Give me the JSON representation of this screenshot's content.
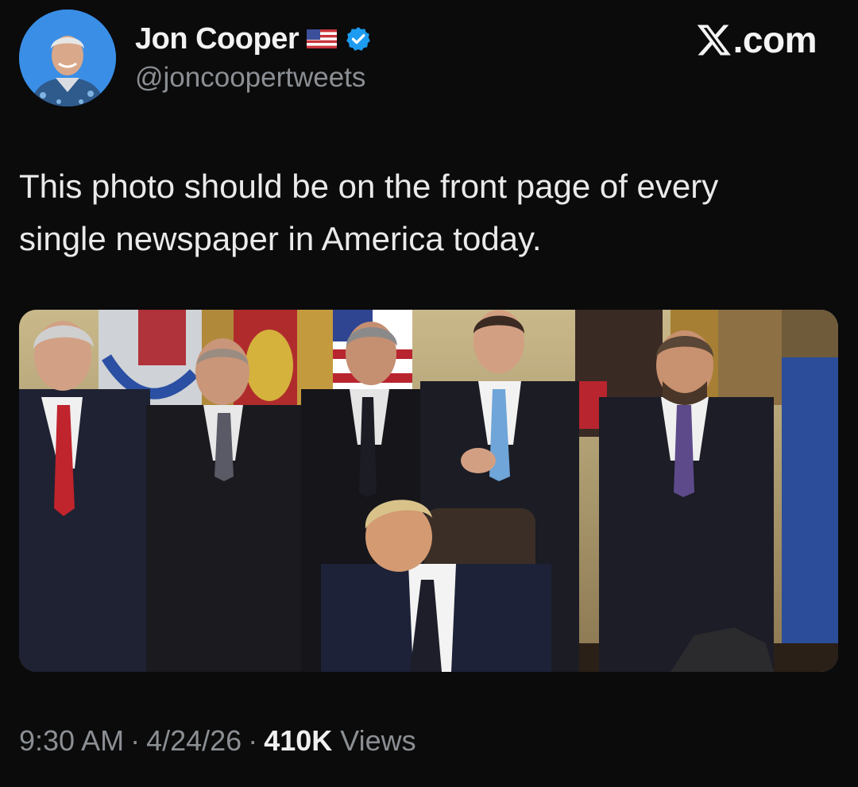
{
  "author": {
    "display_name": "Jon Cooper",
    "handle": "@joncoopertweets",
    "flag_icon": "us-flag-icon",
    "verified_icon": "verified-badge-icon",
    "verified_color": "#1d9bf0"
  },
  "brand": {
    "text": ".com",
    "logo_icon": "x-logo-icon"
  },
  "tweet": {
    "text_lines": [
      "This photo should be on the front page of every",
      "single newspaper in America today."
    ],
    "time": "9:30 AM",
    "date": "4/24/26",
    "separator": "·",
    "views_count": "410K",
    "views_label": "Views"
  },
  "colors": {
    "background": "#0b0b0b",
    "text": "#e7e9ea",
    "muted": "#8b8f94"
  }
}
